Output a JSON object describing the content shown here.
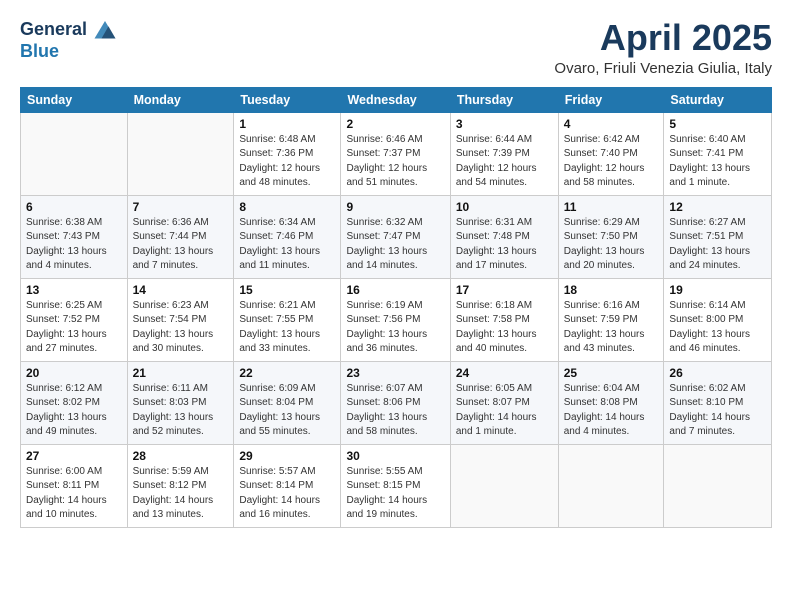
{
  "header": {
    "logo_line1": "General",
    "logo_line2": "Blue",
    "month": "April 2025",
    "location": "Ovaro, Friuli Venezia Giulia, Italy"
  },
  "days_of_week": [
    "Sunday",
    "Monday",
    "Tuesday",
    "Wednesday",
    "Thursday",
    "Friday",
    "Saturday"
  ],
  "weeks": [
    [
      {
        "day": "",
        "info": ""
      },
      {
        "day": "",
        "info": ""
      },
      {
        "day": "1",
        "info": "Sunrise: 6:48 AM\nSunset: 7:36 PM\nDaylight: 12 hours\nand 48 minutes."
      },
      {
        "day": "2",
        "info": "Sunrise: 6:46 AM\nSunset: 7:37 PM\nDaylight: 12 hours\nand 51 minutes."
      },
      {
        "day": "3",
        "info": "Sunrise: 6:44 AM\nSunset: 7:39 PM\nDaylight: 12 hours\nand 54 minutes."
      },
      {
        "day": "4",
        "info": "Sunrise: 6:42 AM\nSunset: 7:40 PM\nDaylight: 12 hours\nand 58 minutes."
      },
      {
        "day": "5",
        "info": "Sunrise: 6:40 AM\nSunset: 7:41 PM\nDaylight: 13 hours\nand 1 minute."
      }
    ],
    [
      {
        "day": "6",
        "info": "Sunrise: 6:38 AM\nSunset: 7:43 PM\nDaylight: 13 hours\nand 4 minutes."
      },
      {
        "day": "7",
        "info": "Sunrise: 6:36 AM\nSunset: 7:44 PM\nDaylight: 13 hours\nand 7 minutes."
      },
      {
        "day": "8",
        "info": "Sunrise: 6:34 AM\nSunset: 7:46 PM\nDaylight: 13 hours\nand 11 minutes."
      },
      {
        "day": "9",
        "info": "Sunrise: 6:32 AM\nSunset: 7:47 PM\nDaylight: 13 hours\nand 14 minutes."
      },
      {
        "day": "10",
        "info": "Sunrise: 6:31 AM\nSunset: 7:48 PM\nDaylight: 13 hours\nand 17 minutes."
      },
      {
        "day": "11",
        "info": "Sunrise: 6:29 AM\nSunset: 7:50 PM\nDaylight: 13 hours\nand 20 minutes."
      },
      {
        "day": "12",
        "info": "Sunrise: 6:27 AM\nSunset: 7:51 PM\nDaylight: 13 hours\nand 24 minutes."
      }
    ],
    [
      {
        "day": "13",
        "info": "Sunrise: 6:25 AM\nSunset: 7:52 PM\nDaylight: 13 hours\nand 27 minutes."
      },
      {
        "day": "14",
        "info": "Sunrise: 6:23 AM\nSunset: 7:54 PM\nDaylight: 13 hours\nand 30 minutes."
      },
      {
        "day": "15",
        "info": "Sunrise: 6:21 AM\nSunset: 7:55 PM\nDaylight: 13 hours\nand 33 minutes."
      },
      {
        "day": "16",
        "info": "Sunrise: 6:19 AM\nSunset: 7:56 PM\nDaylight: 13 hours\nand 36 minutes."
      },
      {
        "day": "17",
        "info": "Sunrise: 6:18 AM\nSunset: 7:58 PM\nDaylight: 13 hours\nand 40 minutes."
      },
      {
        "day": "18",
        "info": "Sunrise: 6:16 AM\nSunset: 7:59 PM\nDaylight: 13 hours\nand 43 minutes."
      },
      {
        "day": "19",
        "info": "Sunrise: 6:14 AM\nSunset: 8:00 PM\nDaylight: 13 hours\nand 46 minutes."
      }
    ],
    [
      {
        "day": "20",
        "info": "Sunrise: 6:12 AM\nSunset: 8:02 PM\nDaylight: 13 hours\nand 49 minutes."
      },
      {
        "day": "21",
        "info": "Sunrise: 6:11 AM\nSunset: 8:03 PM\nDaylight: 13 hours\nand 52 minutes."
      },
      {
        "day": "22",
        "info": "Sunrise: 6:09 AM\nSunset: 8:04 PM\nDaylight: 13 hours\nand 55 minutes."
      },
      {
        "day": "23",
        "info": "Sunrise: 6:07 AM\nSunset: 8:06 PM\nDaylight: 13 hours\nand 58 minutes."
      },
      {
        "day": "24",
        "info": "Sunrise: 6:05 AM\nSunset: 8:07 PM\nDaylight: 14 hours\nand 1 minute."
      },
      {
        "day": "25",
        "info": "Sunrise: 6:04 AM\nSunset: 8:08 PM\nDaylight: 14 hours\nand 4 minutes."
      },
      {
        "day": "26",
        "info": "Sunrise: 6:02 AM\nSunset: 8:10 PM\nDaylight: 14 hours\nand 7 minutes."
      }
    ],
    [
      {
        "day": "27",
        "info": "Sunrise: 6:00 AM\nSunset: 8:11 PM\nDaylight: 14 hours\nand 10 minutes."
      },
      {
        "day": "28",
        "info": "Sunrise: 5:59 AM\nSunset: 8:12 PM\nDaylight: 14 hours\nand 13 minutes."
      },
      {
        "day": "29",
        "info": "Sunrise: 5:57 AM\nSunset: 8:14 PM\nDaylight: 14 hours\nand 16 minutes."
      },
      {
        "day": "30",
        "info": "Sunrise: 5:55 AM\nSunset: 8:15 PM\nDaylight: 14 hours\nand 19 minutes."
      },
      {
        "day": "",
        "info": ""
      },
      {
        "day": "",
        "info": ""
      },
      {
        "day": "",
        "info": ""
      }
    ]
  ]
}
